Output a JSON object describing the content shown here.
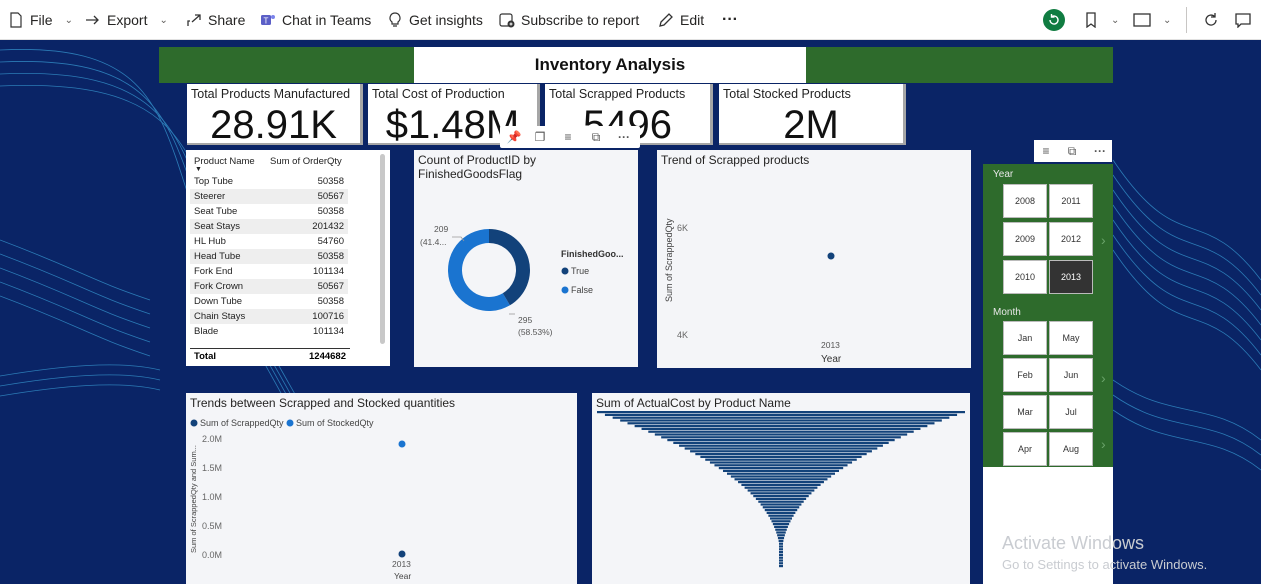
{
  "toolbar": {
    "file": "File",
    "export": "Export",
    "share": "Share",
    "chat_in_teams": "Chat in Teams",
    "get_insights": "Get insights",
    "subscribe": "Subscribe to report",
    "edit": "Edit",
    "more": "···"
  },
  "report": {
    "title": "Inventory Analysis"
  },
  "cards": [
    {
      "label": "Total Products Manufactured",
      "value": "28.91K"
    },
    {
      "label": "Total Cost of Production",
      "value": "$1.48M"
    },
    {
      "label": "Total Scrapped Products",
      "value": "5496"
    },
    {
      "label": "Total Stocked Products",
      "value": "2M"
    }
  ],
  "product_table": {
    "col1": "Product Name",
    "col2": "Sum of OrderQty",
    "rows": [
      {
        "name": "Top Tube",
        "qty": "50358"
      },
      {
        "name": "Steerer",
        "qty": "50567"
      },
      {
        "name": "Seat Tube",
        "qty": "50358"
      },
      {
        "name": "Seat Stays",
        "qty": "201432"
      },
      {
        "name": "HL Hub",
        "qty": "54760"
      },
      {
        "name": "Head Tube",
        "qty": "50358"
      },
      {
        "name": "Fork End",
        "qty": "101134"
      },
      {
        "name": "Fork Crown",
        "qty": "50567"
      },
      {
        "name": "Down Tube",
        "qty": "50358"
      },
      {
        "name": "Chain Stays",
        "qty": "100716"
      },
      {
        "name": "Blade",
        "qty": "101134"
      }
    ],
    "total_label": "Total",
    "total_value": "1244682"
  },
  "donut": {
    "title_line1": "Count of ProductID by",
    "title_line2": "FinishedGoodsFlag",
    "legend_title": "FinishedGoo...",
    "label_true_1": "209",
    "label_true_2": "(41.4...",
    "label_false_1": "295",
    "label_false_2": "(58.53%)",
    "legend_true": "True",
    "legend_false": "False"
  },
  "scrapped_trend": {
    "title": "Trend of Scrapped products",
    "ylabel": "Sum of ScrappedQty",
    "xlabel": "Year",
    "tick_6k": "6K",
    "tick_4k": "4K",
    "x_tick": "2013"
  },
  "slicer": {
    "year_label": "Year",
    "years": [
      "2008",
      "2011",
      "2009",
      "2012",
      "2010",
      "2013"
    ],
    "selected_year": "2013",
    "month_label": "Month",
    "months": [
      "Jan",
      "May",
      "Feb",
      "Jun",
      "Mar",
      "Jul",
      "Apr",
      "Aug"
    ]
  },
  "trends": {
    "title": "Trends between Scrapped and Stocked quantities",
    "legend_scrapped": "Sum of ScrappedQty",
    "legend_stocked": "Sum of StockedQty",
    "ylabel": "Sum of ScrappedQty and Sum...",
    "ticks": [
      "2.0M",
      "1.5M",
      "1.0M",
      "0.5M",
      "0.0M"
    ],
    "x_tick": "2013",
    "xlabel": "Year"
  },
  "actual_cost": {
    "title": "Sum of ActualCost by Product Name"
  },
  "watermark": {
    "line1": "Activate Windows",
    "line2": "Go to Settings to activate Windows."
  },
  "colors": {
    "canvas": "#0a2466",
    "title_band": "#2e6b2c",
    "series_dark": "#12427a",
    "series_light": "#1a74d0",
    "accent": "#107c41"
  },
  "chart_data": [
    {
      "type": "pie",
      "categories": [
        "True",
        "False"
      ],
      "values": [
        209,
        295
      ],
      "percentages": [
        41.47,
        58.53
      ],
      "title": "Count of ProductID by FinishedGoodsFlag"
    },
    {
      "type": "scatter",
      "title": "Trend of Scrapped products",
      "x": [
        "2013"
      ],
      "values": [
        5496
      ],
      "xlabel": "Year",
      "ylabel": "Sum of ScrappedQty",
      "yticks": [
        "4K",
        "6K"
      ],
      "ylim": [
        3500,
        6700
      ]
    },
    {
      "type": "scatter",
      "title": "Trends between Scrapped and Stocked quantities",
      "x": [
        "2013"
      ],
      "series": [
        {
          "name": "Sum of ScrappedQty",
          "values": [
            5496
          ]
        },
        {
          "name": "Sum of StockedQty",
          "values": [
            1900000
          ]
        }
      ],
      "xlabel": "Year",
      "ylabel": "Sum of ScrappedQty and Sum...",
      "ylim": [
        0,
        2000000
      ]
    },
    {
      "type": "bar",
      "title": "Sum of ActualCost by Product Name",
      "orientation": "horizontal-funnel"
    }
  ]
}
